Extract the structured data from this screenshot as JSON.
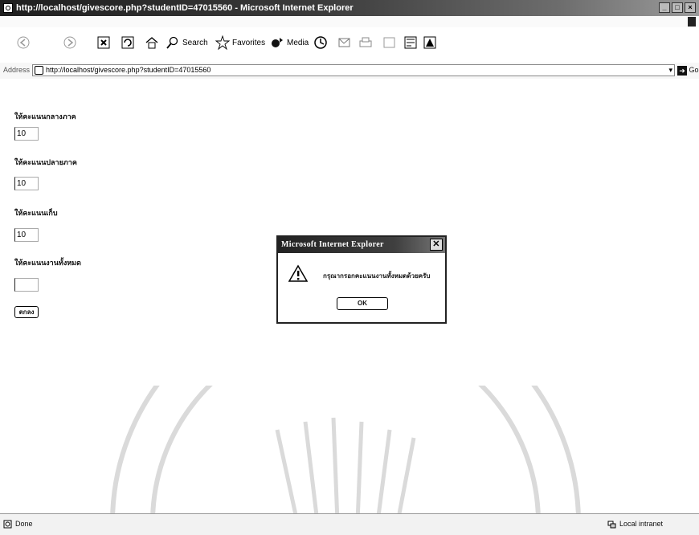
{
  "window": {
    "title": "http://localhost/givescore.php?studentID=47015560 - Microsoft Internet Explorer"
  },
  "toolbar": {
    "search_label": "Search",
    "favorites_label": "Favorites",
    "media_label": "Media"
  },
  "address": {
    "label": "Address",
    "url": "http://localhost/givescore.php?studentID=47015560",
    "go_label": "Go"
  },
  "form": {
    "fields": [
      {
        "label": "ให้คะแนนกลางภาค",
        "value": "10"
      },
      {
        "label": "ให้คะแนนปลายภาค",
        "value": "10"
      },
      {
        "label": "ให้คะแนนเก็บ",
        "value": "10"
      },
      {
        "label": "ให้คะแนนงานทั้งหมด",
        "value": ""
      }
    ],
    "submit_label": "ตกลง"
  },
  "dialog": {
    "title": "Microsoft Internet Explorer",
    "message": "กรุณากรอกคะแนนงานทั้งหมดด้วยครับ",
    "ok_label": "OK"
  },
  "status": {
    "left_text": "Done",
    "zone_text": "Local intranet"
  },
  "colors": {
    "titlebar": "#2a2a2a",
    "dialog_titlebar": "#333333"
  },
  "icons": [
    "ie-page-icon",
    "back-icon",
    "forward-icon",
    "stop-icon",
    "refresh-icon",
    "home-icon",
    "search-icon",
    "favorites-star-icon",
    "media-icon",
    "history-icon",
    "mail-icon",
    "print-icon",
    "edit-icon",
    "messenger-icon",
    "go-arrow-icon",
    "warning-icon",
    "close-icon",
    "done-page-icon",
    "local-intranet-icon"
  ]
}
